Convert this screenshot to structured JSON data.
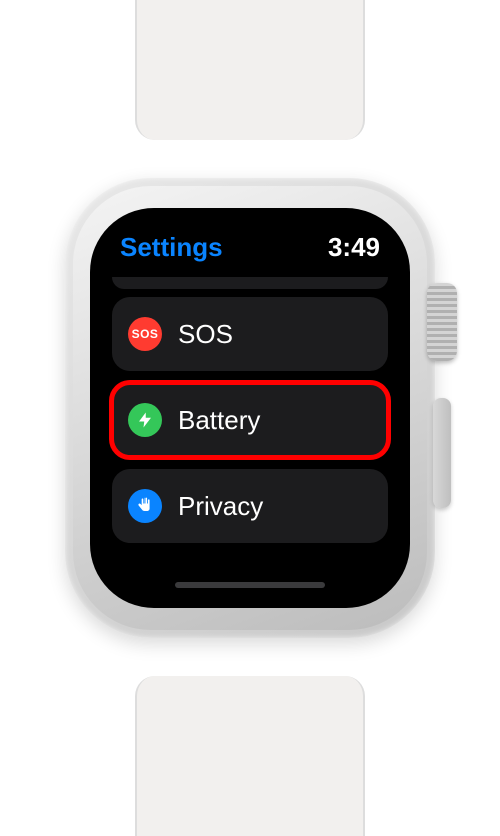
{
  "header": {
    "back_label": "Settings",
    "time": "3:49"
  },
  "items": [
    {
      "label": "SOS",
      "icon": "sos",
      "highlighted": false
    },
    {
      "label": "Battery",
      "icon": "battery",
      "highlighted": true
    },
    {
      "label": "Privacy",
      "icon": "privacy",
      "highlighted": false
    }
  ],
  "icons": {
    "sos_text": "SOS"
  }
}
